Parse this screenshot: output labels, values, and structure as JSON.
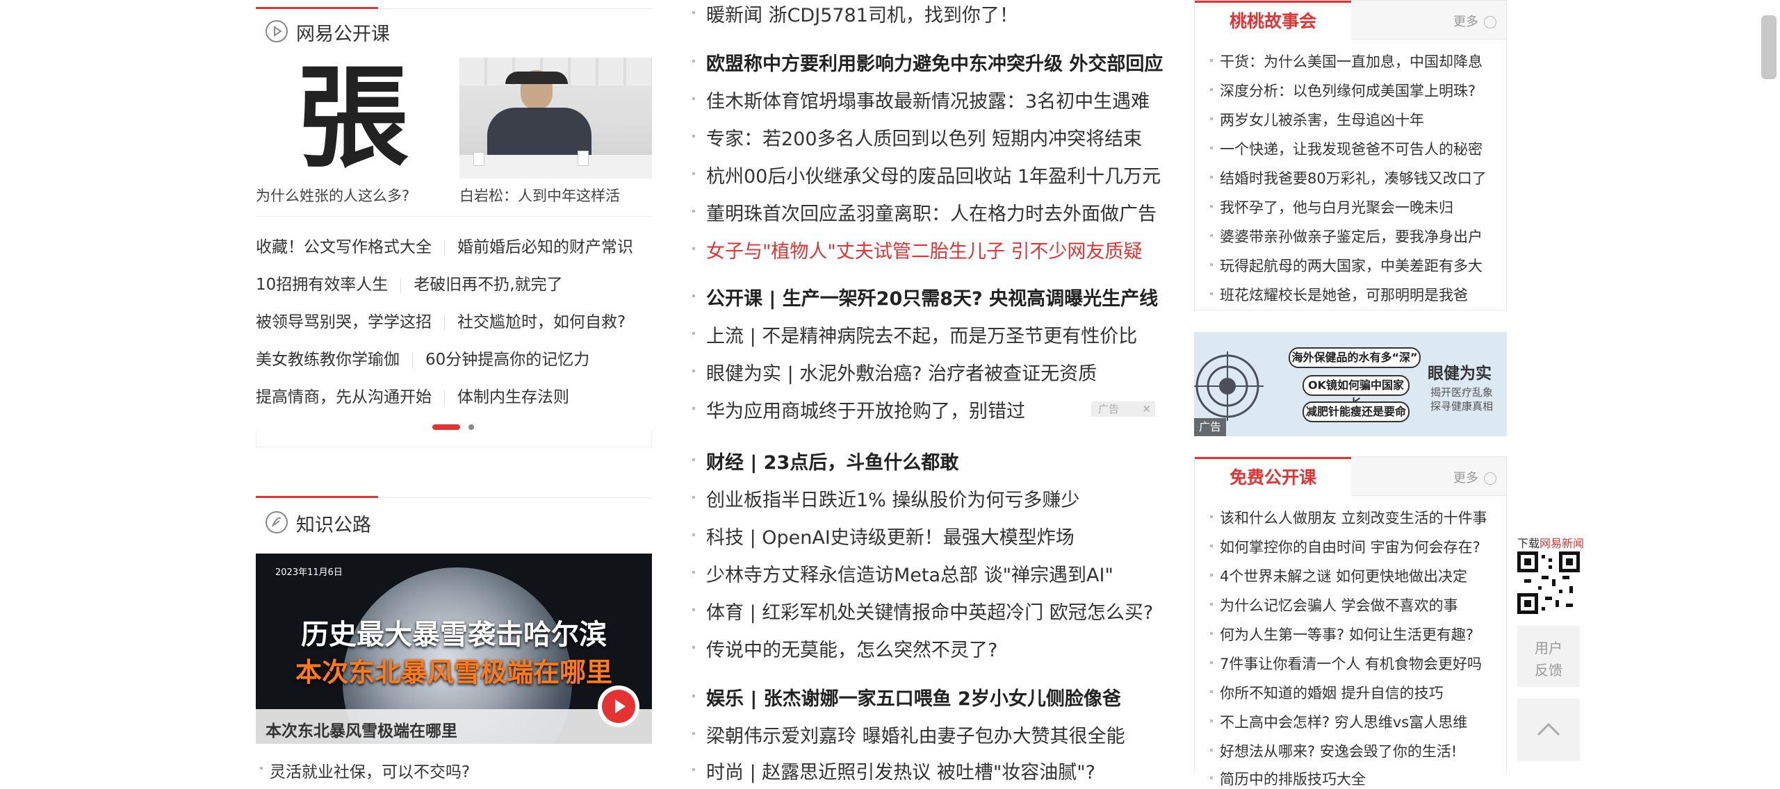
{
  "left": {
    "opencourse": {
      "title": "网易公开课",
      "thumbs": [
        {
          "caption": "为什么姓张的人这么多?",
          "glyph": "張"
        },
        {
          "caption": "白岩松：人到中年这样活"
        }
      ],
      "links": [
        [
          "收藏！公文写作格式大全",
          "婚前婚后必知的财产常识"
        ],
        [
          "10招拥有效率人生",
          "老破旧再不扔,就完了"
        ],
        [
          "被领导骂别哭，学学这招",
          "社交尴尬时，如何自救?"
        ],
        [
          "美女教练教你学瑜伽",
          "60分钟提高你的记忆力"
        ],
        [
          "提高情商，先从沟通开始",
          "体制内生存法则"
        ]
      ]
    },
    "knowledge": {
      "title": "知识公路",
      "video": {
        "date": "2023年11月6日",
        "headline1": "历史最大暴雪袭击哈尔滨",
        "headline2": "本次东北暴风雪极端在哪里",
        "caption": "本次东北暴风雪极端在哪里"
      },
      "next_item": "灵活就业社保，可以不交吗?"
    }
  },
  "news": [
    {
      "text": "暖新闻 浙CDJ5781司机，找到你了！",
      "style": "normal"
    },
    {
      "text": "欧盟称中方要利用影响力避免中东冲突升级 外交部回应",
      "style": "bold"
    },
    {
      "text": "佳木斯体育馆坍塌事故最新情况披露：3名初中生遇难",
      "style": "normal"
    },
    {
      "text": "专家：若200多名人质回到以色列 短期内冲突将结束",
      "style": "normal"
    },
    {
      "text": "杭州00后小伙继承父母的废品回收站 1年盈利十几万元",
      "style": "normal"
    },
    {
      "text": "董明珠首次回应孟羽童离职：人在格力时去外面做广告",
      "style": "normal"
    },
    {
      "text": "女子与\"植物人\"丈夫试管二胎生儿子 引不少网友质疑",
      "style": "red"
    },
    {
      "text": "公开课 | 生产一架歼20只需8天? 央视高调曝光生产线",
      "style": "bold"
    },
    {
      "text": "上流 | 不是精神病院去不起，而是万圣节更有性价比",
      "style": "normal"
    },
    {
      "text": "眼健为实 | 水泥外敷治癌? 治疗者被查证无资质",
      "style": "normal"
    },
    {
      "text": "华为应用商城终于开放抢购了，别错过",
      "style": "normal"
    },
    {
      "text": "财经 | 23点后，斗鱼什么都敢",
      "style": "bold"
    },
    {
      "text": "创业板指半日跌近1% 操纵股价为何亏多赚少",
      "style": "normal"
    },
    {
      "text": "科技 | OpenAI史诗级更新！最强大模型炸场",
      "style": "normal"
    },
    {
      "text": "少林寺方丈释永信造访Meta总部 谈\"禅宗遇到AI\"",
      "style": "normal"
    },
    {
      "text": "体育 | 红彩军机处关键情报命中英超冷门 欧冠怎么买?",
      "style": "normal"
    },
    {
      "text": "传说中的无莫能，怎么突然不灵了?",
      "style": "normal"
    },
    {
      "text": "娱乐 | 张杰谢娜一家五口喂鱼 2岁小女儿侧脸像爸",
      "style": "bold"
    },
    {
      "text": "梁朝伟示爱刘嘉玲 曝婚礼由妻子包办大赞其很全能",
      "style": "normal"
    },
    {
      "text": "时尚 | 赵露思近照引发热议 被吐槽\"妆容油腻\"?",
      "style": "normal"
    }
  ],
  "ad_small": {
    "label": "广告",
    "close": "✕"
  },
  "right": {
    "stories": {
      "title": "桃桃故事会",
      "more": "更多",
      "items": [
        "干货：为什么美国一直加息，中国却降息",
        "深度分析：以色列缘何成美国掌上明珠?",
        "两岁女儿被杀害，生母追凶十年",
        "一个快递，让我发现爸爸不可告人的秘密",
        "结婚时我爸要80万彩礼，凑够钱又改口了",
        "我怀孕了，他与白月光聚会一晚未归",
        "婆婆带亲孙做亲子鉴定后，要我净身出户",
        "玩得起航母的两大国家，中美差距有多大",
        "班花炫耀校长是她爸，可那明明是我爸"
      ]
    },
    "ad": {
      "line1": "海外保健品的水有多“深”",
      "line2": "OK镜如何骗中国家长",
      "line3": "减肥针能瘦还是要命",
      "brand": "眼健为实",
      "sub1": "揭开医疗乱象",
      "sub2": "探寻健康真相",
      "tag": "广告"
    },
    "free": {
      "title": "免费公开课",
      "more": "更多",
      "items": [
        "该和什么人做朋友 立刻改变生活的十件事",
        "如何掌控你的自由时间 宇宙为何会存在?",
        "4个世界未解之谜 如何更快地做出决定",
        "为什么记忆会骗人 学会做不喜欢的事",
        "何为人生第一等事? 如何让生活更有趣?",
        "7件事让你看清一个人 有机食物会更好吗",
        "你所不知道的婚姻 提升自信的技巧",
        "不上高中会怎样?  穷人思维vs富人思维",
        "好想法从哪来?  安逸会毁了你的生活!",
        "简历中的排版技巧大全"
      ]
    }
  },
  "widgets": {
    "download_prefix": "下载",
    "download_brand": "网易新闻",
    "feedback_line1": "用户",
    "feedback_line2": "反馈"
  }
}
